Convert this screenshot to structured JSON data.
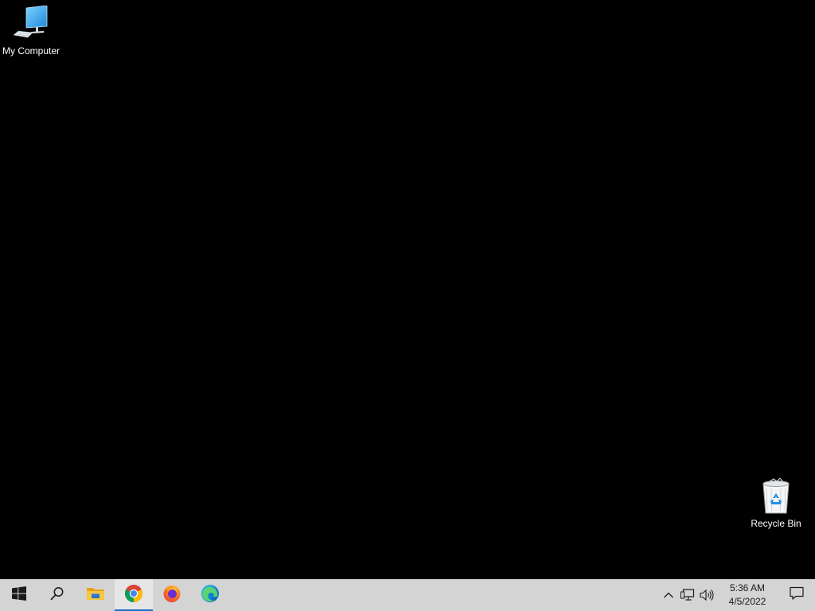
{
  "desktop": {
    "background_color": "#000000",
    "icons": [
      {
        "label": "My Computer",
        "icon": "computer-icon"
      },
      {
        "label": "Recycle Bin",
        "icon": "recycle-bin-icon"
      }
    ]
  },
  "taskbar": {
    "background_color": "#d4d4d4",
    "accent_color": "#1a73c9",
    "buttons": [
      {
        "name": "start",
        "icon": "windows-logo-icon"
      },
      {
        "name": "search",
        "icon": "search-icon"
      },
      {
        "name": "file-explorer",
        "icon": "folder-icon"
      },
      {
        "name": "chrome",
        "icon": "chrome-icon",
        "active": true
      },
      {
        "name": "firefox",
        "icon": "firefox-icon"
      },
      {
        "name": "edge",
        "icon": "edge-icon"
      }
    ],
    "tray": {
      "icons": [
        "chevron-up-icon",
        "network-icon",
        "volume-icon"
      ],
      "time": "5:36 AM",
      "date": "4/5/2022",
      "notification_icon": "notification-icon"
    }
  }
}
